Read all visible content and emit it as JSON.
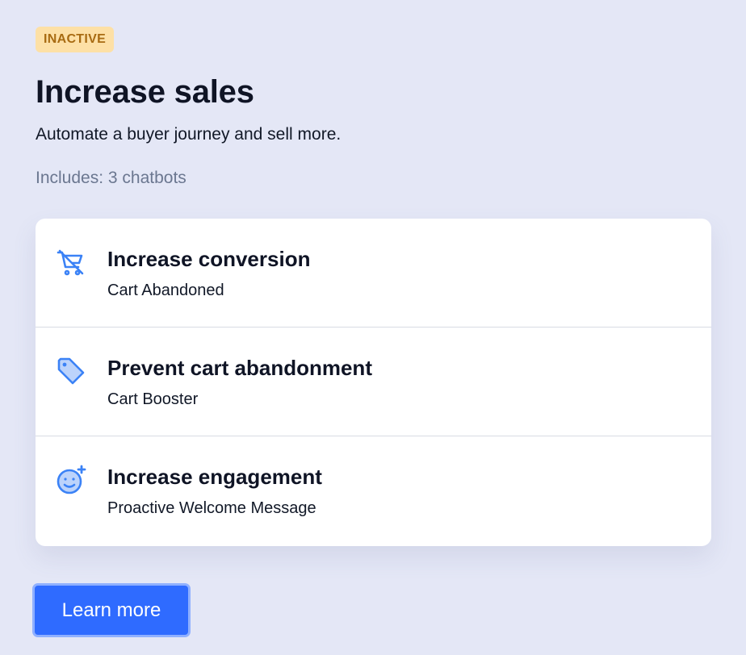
{
  "status_badge": "INACTIVE",
  "title": "Increase sales",
  "subtitle": "Automate a buyer journey and sell more.",
  "includes": "Includes: 3 chatbots",
  "chatbots": [
    {
      "title": "Increase conversion",
      "subtitle": "Cart Abandoned",
      "icon": "cart-off-icon"
    },
    {
      "title": "Prevent cart abandonment",
      "subtitle": "Cart Booster",
      "icon": "tag-icon"
    },
    {
      "title": "Increase engagement",
      "subtitle": "Proactive Welcome Message",
      "icon": "smile-plus-icon"
    }
  ],
  "learn_more_label": "Learn more",
  "colors": {
    "background": "#e4e7f6",
    "badge_bg": "#fde0a6",
    "badge_text": "#a86b12",
    "accent": "#2f6bff",
    "icon_blue": "#3b82f6"
  }
}
